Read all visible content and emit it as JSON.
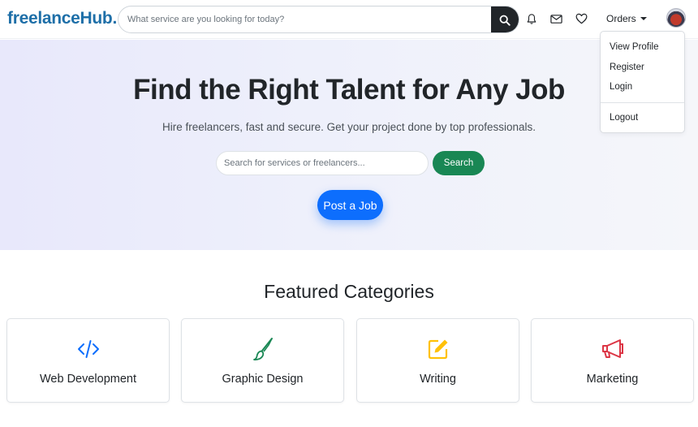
{
  "navbar": {
    "logo": "freelanceHub.",
    "search_placeholder": "What service are you looking for today?",
    "icons": [
      "search-icon",
      "bell-icon",
      "envelope-icon",
      "heart-icon"
    ],
    "orders_label": "Orders"
  },
  "dropdown": {
    "items": [
      "View Profile",
      "Register",
      "Login"
    ],
    "logout": "Logout"
  },
  "hero": {
    "title": "Find the Right Talent for Any Job",
    "subtitle": "Hire freelancers, fast and secure. Get your project done by top professionals.",
    "search_placeholder": "Search for services or freelancers...",
    "search_button": "Search",
    "post_job_button": "Post a Job"
  },
  "featured": {
    "title": "Featured Categories",
    "categories": [
      {
        "label": "Web Development",
        "icon": "code-icon",
        "color": "#0d6efd"
      },
      {
        "label": "Graphic Design",
        "icon": "brush-icon",
        "color": "#198754"
      },
      {
        "label": "Writing",
        "icon": "pencil-square-icon",
        "color": "#ffc107"
      },
      {
        "label": "Marketing",
        "icon": "megaphone-icon",
        "color": "#dc3545"
      }
    ]
  },
  "colors": {
    "logo": "#1e6fa8",
    "search_btn": "#212529",
    "hero_search_btn": "#198754",
    "post_job_btn": "#0d6efd"
  }
}
